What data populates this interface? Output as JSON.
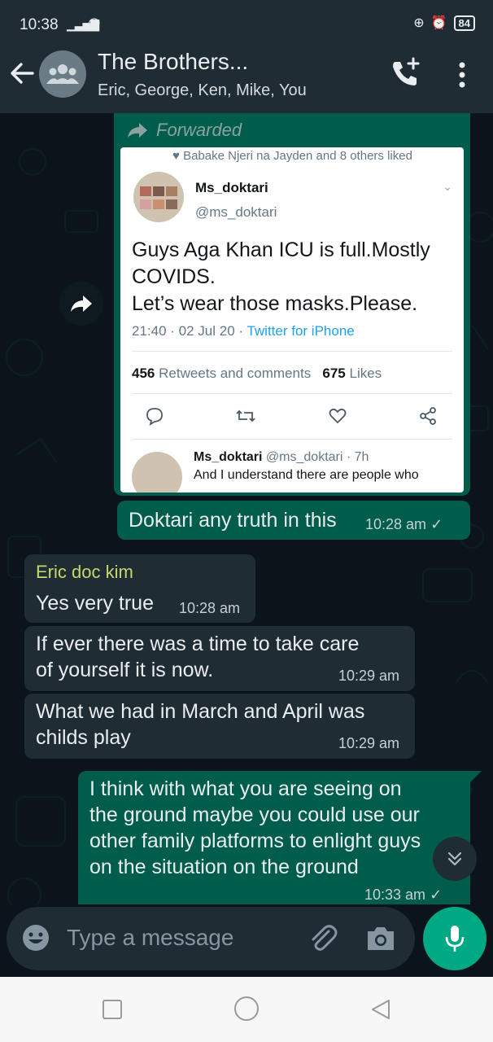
{
  "status_bar": {
    "time": "10:38",
    "battery": "84"
  },
  "header": {
    "title": "The Brothers...",
    "subtitle": "Eric, George, Ken, Mike, You"
  },
  "forwarded": {
    "label": "Forwarded",
    "tweet": {
      "liked_by": "Babake Njeri na Jayden and 8 others liked",
      "name": "Ms_doktari",
      "handle": "@ms_doktari",
      "text_line1": "Guys Aga Khan ICU is full.Mostly",
      "text_line2": "COVIDS.",
      "text_line3": "Let’s wear those masks.Please.",
      "date": "21:40 · 02 Jul 20 · ",
      "source": "Twitter for iPhone",
      "retweets_count": "456",
      "retweets_label": "Retweets and comments",
      "likes_count": "675",
      "likes_label": "Likes",
      "reply_name": "Ms_doktari",
      "reply_handle_time": "@ms_doktari · 7h",
      "reply_text": "And I understand there are people who"
    }
  },
  "messages": [
    {
      "text": "Doktari any truth in this",
      "time": "10:28 am"
    },
    {
      "sender": "Eric doc kim",
      "text": "Yes very true",
      "time": "10:28 am"
    },
    {
      "line1": "If ever there was a time to take care",
      "line2": "of yourself it is now.",
      "time": "10:29 am"
    },
    {
      "line1": "What we had in March and April was",
      "line2": "childs play",
      "time": "10:29 am"
    },
    {
      "line1": "I think with what you are seeing on",
      "line2": "the ground maybe you could use our",
      "line3": "other family platforms to enlight guys",
      "line4": "on the situation on the ground",
      "time": "10:33 am"
    }
  ],
  "input": {
    "placeholder": "Type a message"
  },
  "colors": {
    "outgoing": "#005c4b",
    "incoming": "#202c33",
    "accent": "#00a884",
    "sender_name": "#c5d86d"
  }
}
